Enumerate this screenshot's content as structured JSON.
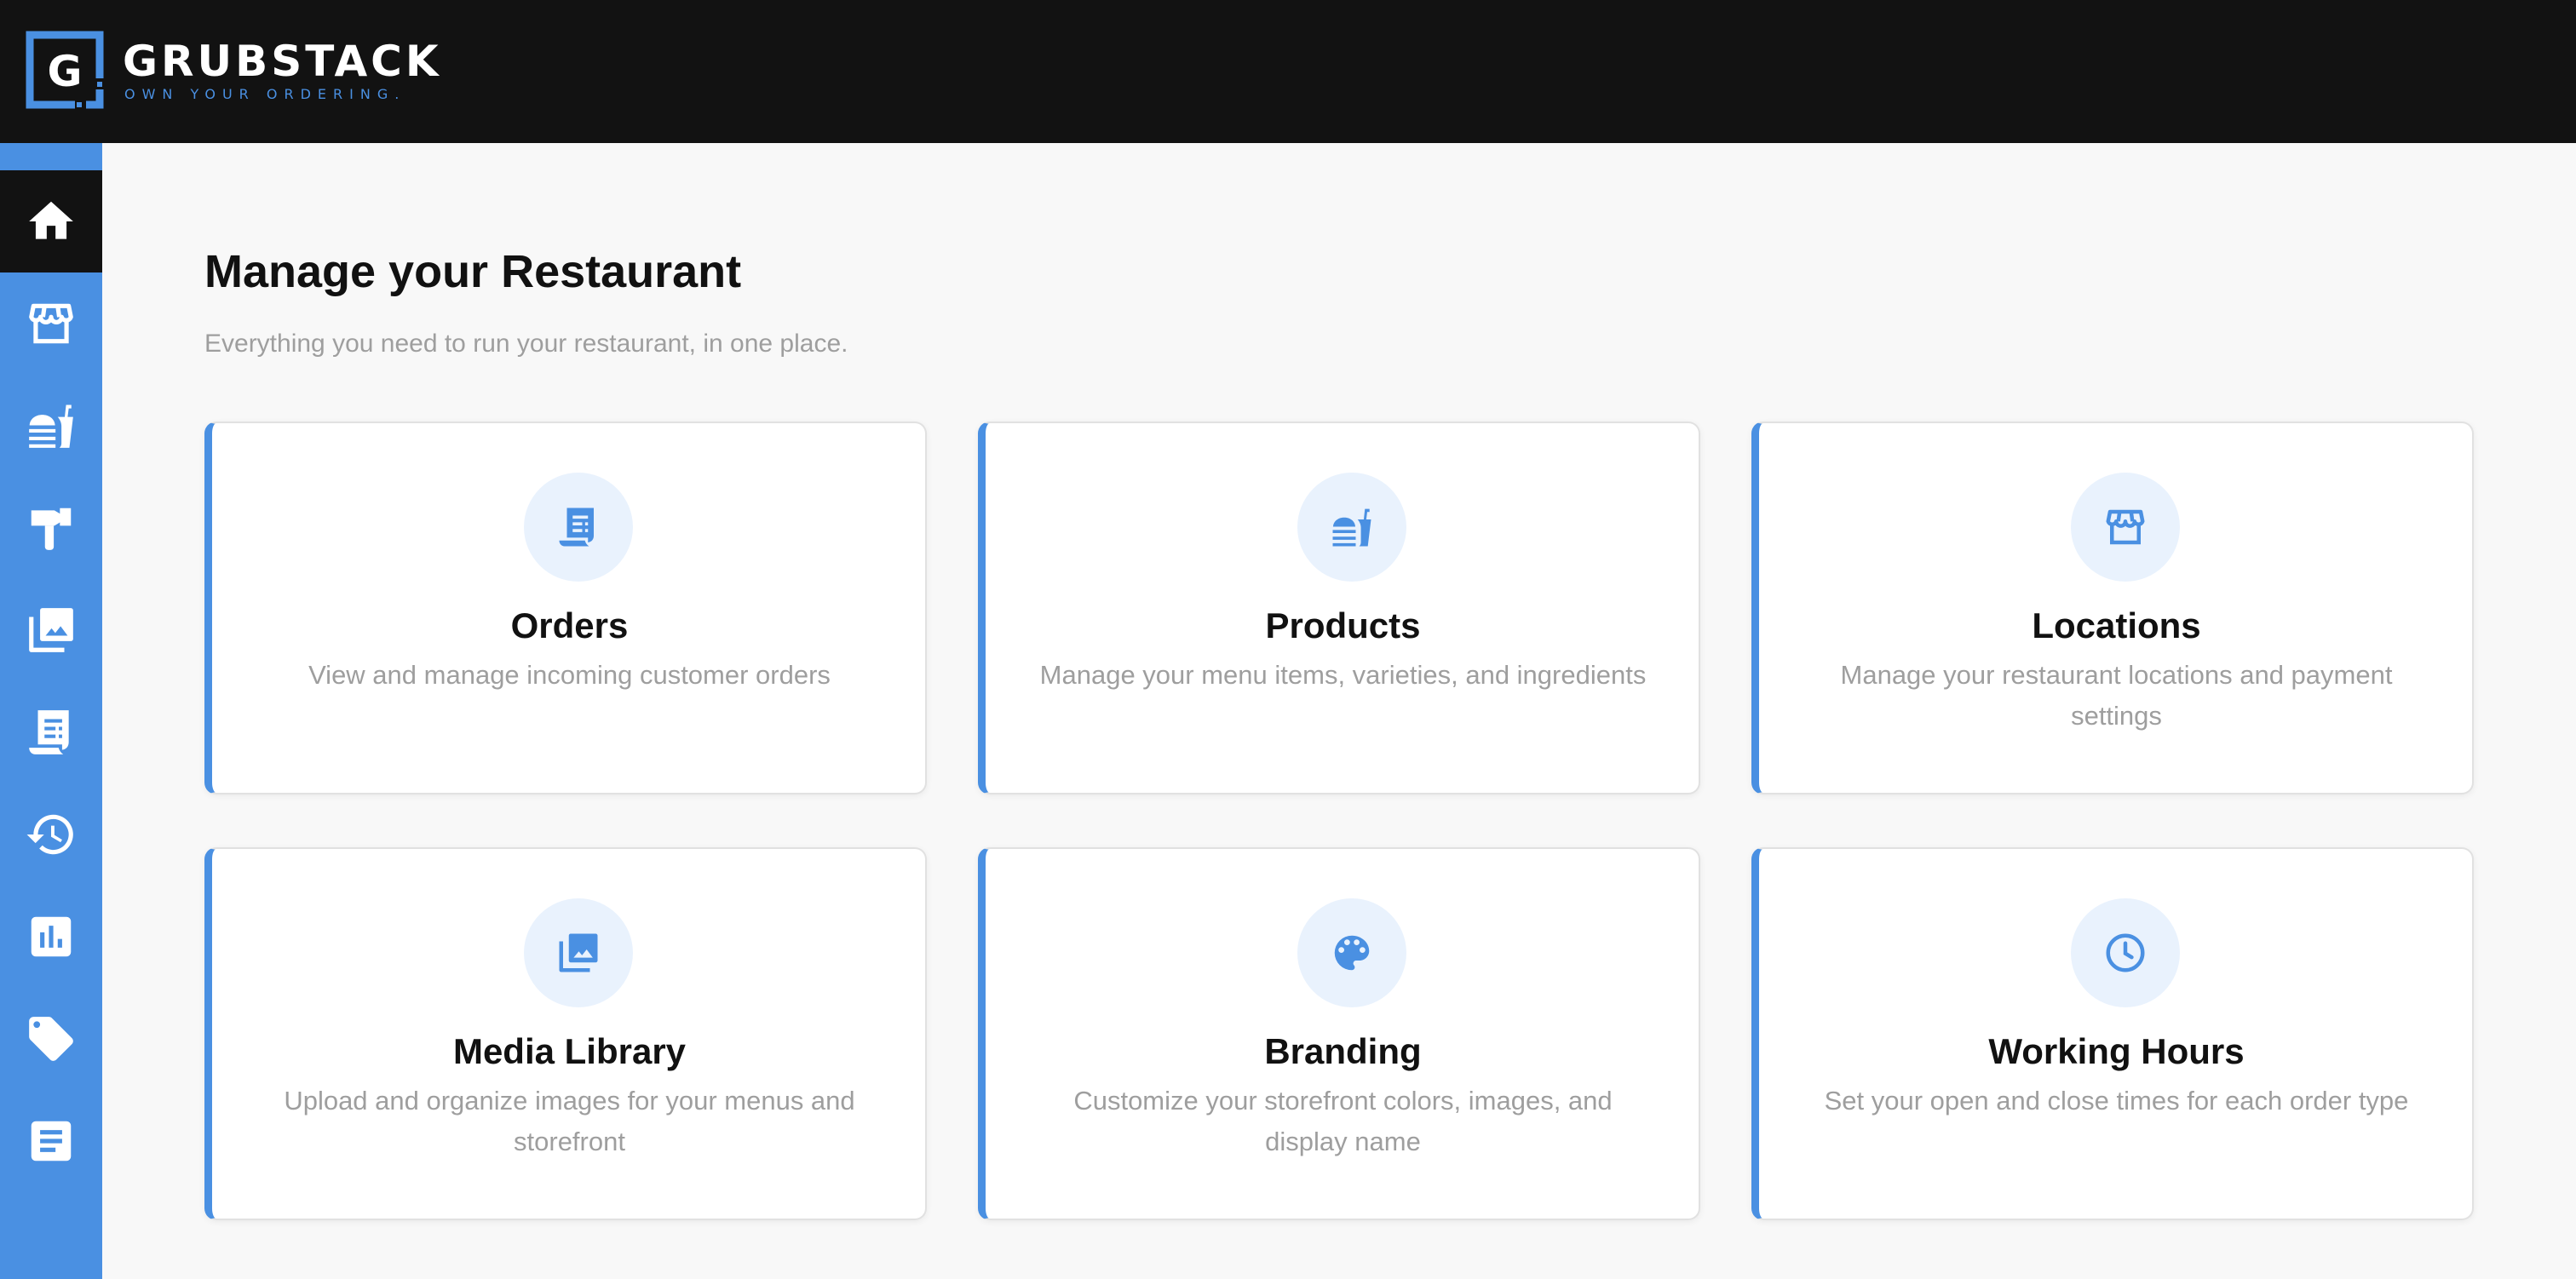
{
  "header": {
    "logo_letter": "G",
    "brand_name": "GRUBSTACK",
    "tagline": "OWN YOUR ORDERING."
  },
  "sidebar": {
    "items": [
      {
        "icon": "home-icon",
        "active": true
      },
      {
        "icon": "storefront-icon",
        "active": false
      },
      {
        "icon": "food-drink-icon",
        "active": false
      },
      {
        "icon": "hammer-icon",
        "active": false
      },
      {
        "icon": "photo-library-icon",
        "active": false
      },
      {
        "icon": "receipt-icon",
        "active": false
      },
      {
        "icon": "history-icon",
        "active": false
      },
      {
        "icon": "bar-chart-icon",
        "active": false
      },
      {
        "icon": "tag-icon",
        "active": false
      },
      {
        "icon": "article-icon",
        "active": false
      }
    ]
  },
  "main": {
    "title": "Manage your Restaurant",
    "subtitle": "Everything you need to run your restaurant, in one place.",
    "cards": [
      {
        "title": "Orders",
        "description": "View and manage incoming customer orders",
        "icon": "receipt-icon"
      },
      {
        "title": "Products",
        "description": "Manage your menu items, varieties, and ingredients",
        "icon": "food-drink-icon"
      },
      {
        "title": "Locations",
        "description": "Manage your restaurant locations and payment settings",
        "icon": "storefront-icon"
      },
      {
        "title": "Media Library",
        "description": "Upload and organize images for your menus and storefront",
        "icon": "photo-library-icon"
      },
      {
        "title": "Branding",
        "description": "Customize your storefront colors, images, and display name",
        "icon": "palette-icon"
      },
      {
        "title": "Working Hours",
        "description": "Set your open and close times for each order type",
        "icon": "clock-icon"
      }
    ]
  },
  "colors": {
    "accent": "#4a90e2",
    "topbar": "#121212",
    "background": "#f8f8f8",
    "icon_circle": "#e9f2fd"
  }
}
